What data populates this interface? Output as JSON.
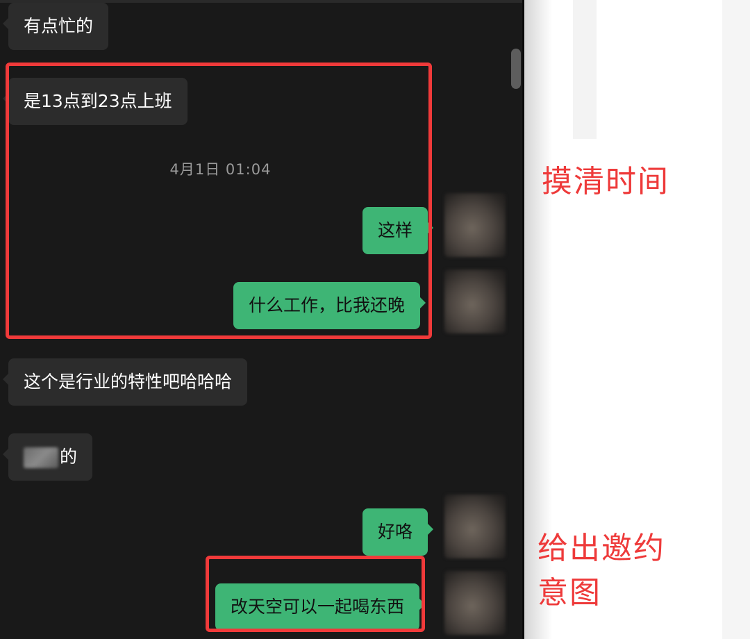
{
  "chat": {
    "messages": [
      {
        "side": "in",
        "text": "有点忙的"
      },
      {
        "side": "in",
        "text": "是13点到23点上班"
      },
      {
        "side": "out",
        "text": "这样"
      },
      {
        "side": "out",
        "text": "什么工作，比我还晚"
      },
      {
        "side": "in",
        "text": "这个是行业的特性吧哈哈哈"
      },
      {
        "side": "in",
        "text": "的"
      },
      {
        "side": "out",
        "text": "好咯"
      },
      {
        "side": "out",
        "text": "改天空可以一起喝东西"
      }
    ],
    "timestamp": "4月1日 01:04"
  },
  "annotations": {
    "first": "摸清时间",
    "second_line1": "给出邀约",
    "second_line2": "意图"
  },
  "colors": {
    "chat_bg": "#191919",
    "incoming_bubble": "#2c2c2c",
    "outgoing_bubble": "#3eb575",
    "highlight": "#f03a3a"
  }
}
